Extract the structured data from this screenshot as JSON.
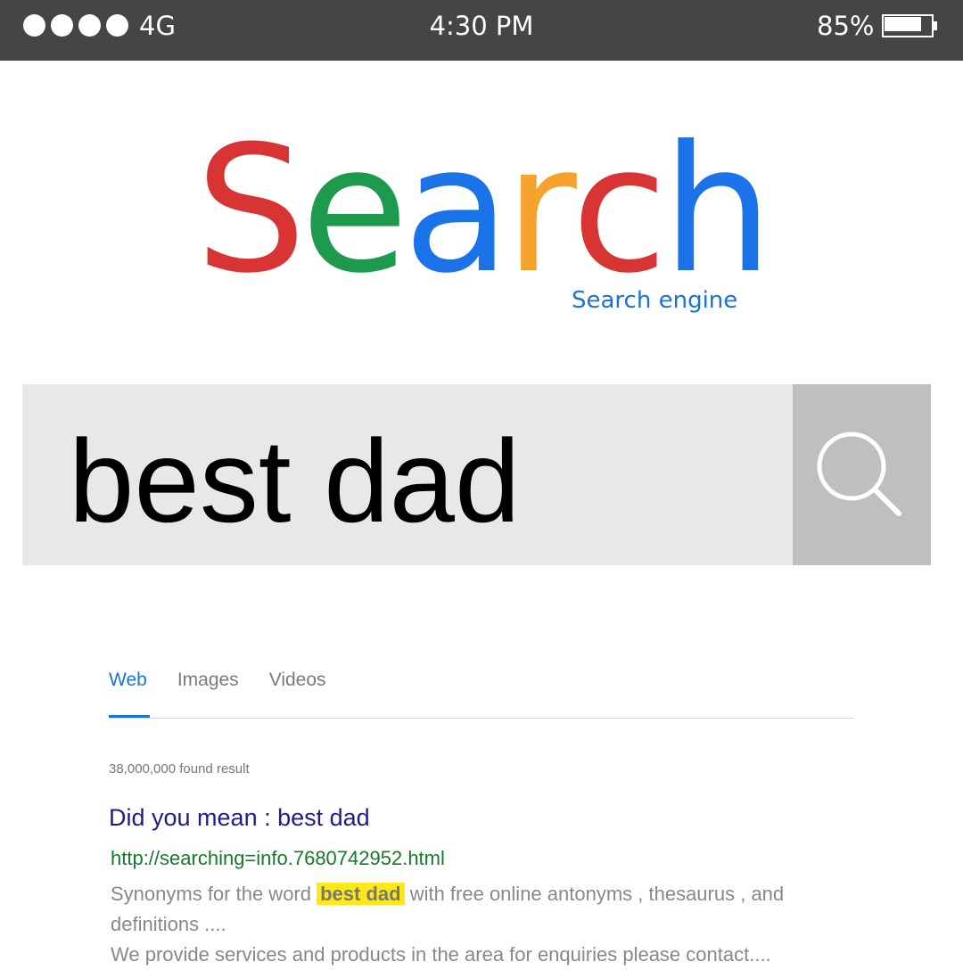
{
  "status_bar": {
    "network": "4G",
    "time": "4:30 PM",
    "battery_percent": "85%",
    "battery_level": 0.85,
    "signal_dots": 4
  },
  "logo": {
    "letters": [
      {
        "char": "S",
        "color": "#d93434"
      },
      {
        "char": "e",
        "color": "#1e9a4f"
      },
      {
        "char": "a",
        "color": "#1a73e8"
      },
      {
        "char": "r",
        "color": "#f5a32e"
      },
      {
        "char": "c",
        "color": "#d93434"
      },
      {
        "char": "h",
        "color": "#1a73e8"
      }
    ],
    "subtitle": "Search engine"
  },
  "search": {
    "query": "best dad",
    "button_icon": "search-icon"
  },
  "tabs": [
    {
      "label": "Web",
      "active": true
    },
    {
      "label": "Images",
      "active": false
    },
    {
      "label": "Videos",
      "active": false
    }
  ],
  "results": {
    "count_text": "38,000,000 found result",
    "title": "Did you mean : best dad",
    "url": "http://searching=info.7680742952.html",
    "snippet_before": "Synonyms for the word",
    "snippet_highlight": "best dad",
    "snippet_after": " with free online antonyms , thesaurus , and definitions ....",
    "snippet_line2": "We provide services and products in the area for enquiries please contact...."
  }
}
